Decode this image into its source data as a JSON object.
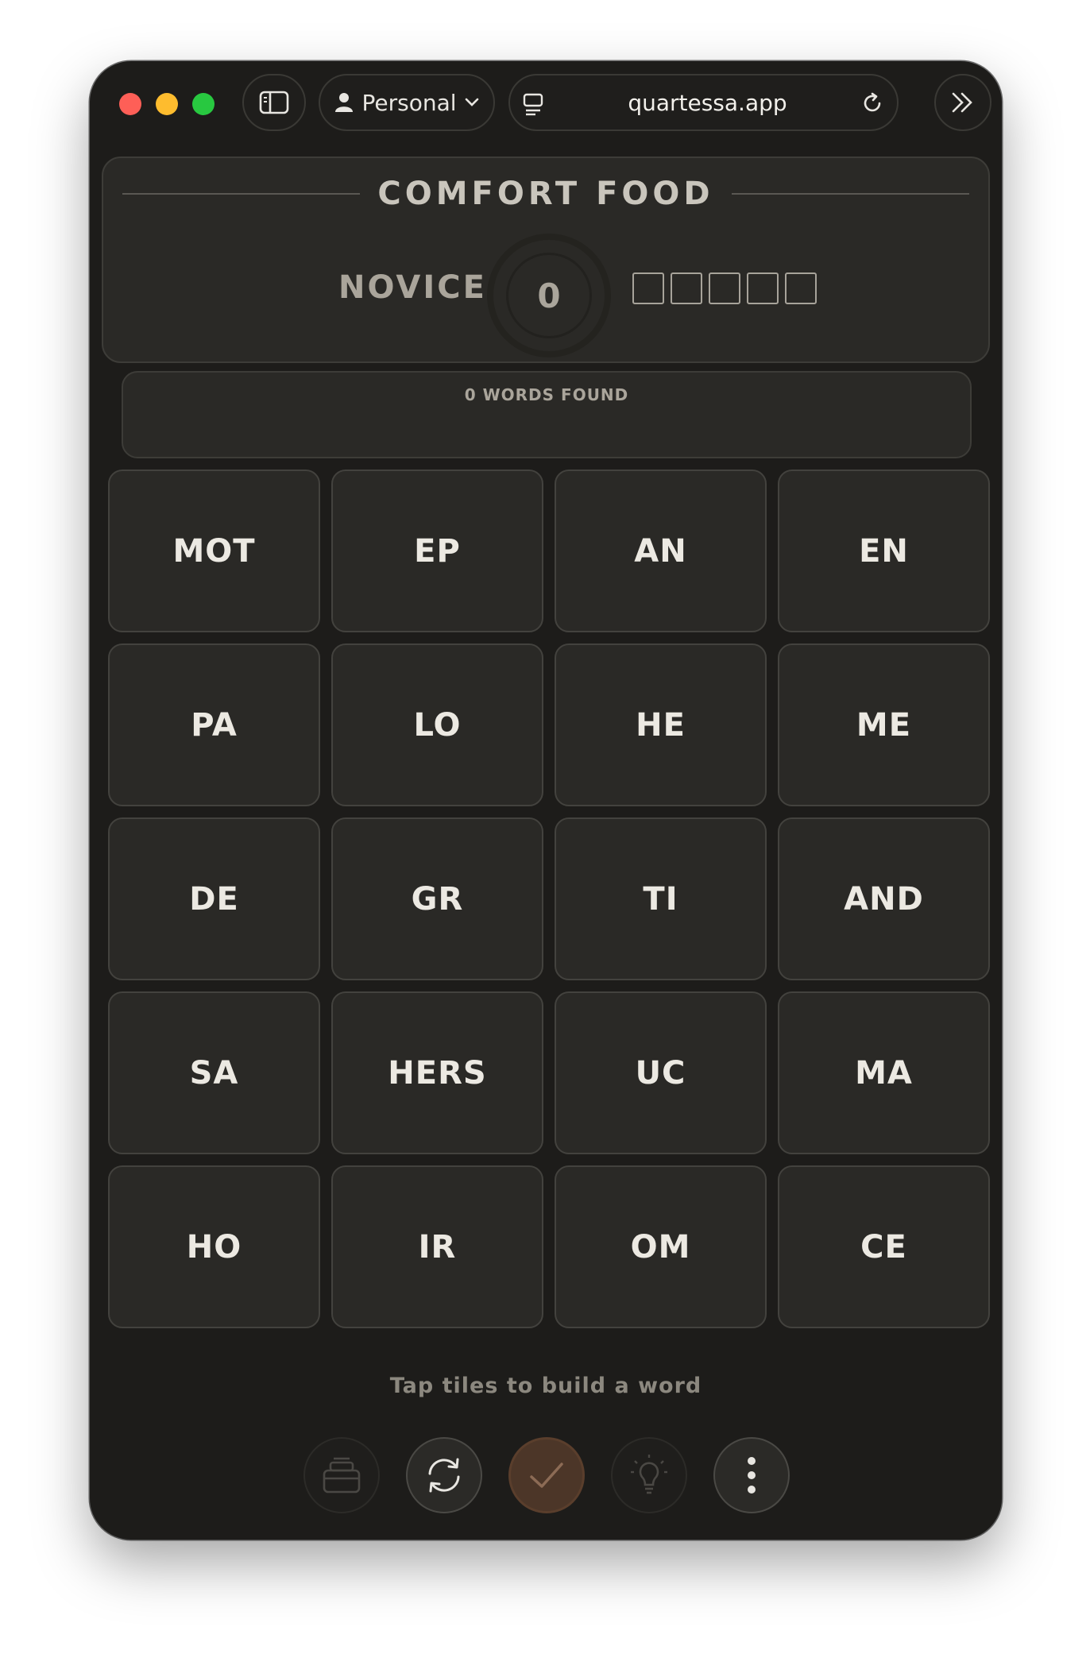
{
  "browser": {
    "profile_label": "Personal",
    "url": "quartessa.app"
  },
  "puzzle": {
    "title": "COMFORT FOOD",
    "level": "NOVICE",
    "score": "0",
    "progress_filled": 0,
    "progress_total": 5,
    "words_found": "0 WORDS FOUND"
  },
  "tiles": [
    "MOT",
    "EP",
    "AN",
    "EN",
    "PA",
    "LO",
    "HE",
    "ME",
    "DE",
    "GR",
    "TI",
    "AND",
    "SA",
    "HERS",
    "UC",
    "MA",
    "HO",
    "IR",
    "OM",
    "CE"
  ],
  "hint_text": "Tap tiles to build a word",
  "colors": {
    "accent": "#4c3628",
    "background": "#1d1c1a",
    "tile": "#2a2926"
  }
}
